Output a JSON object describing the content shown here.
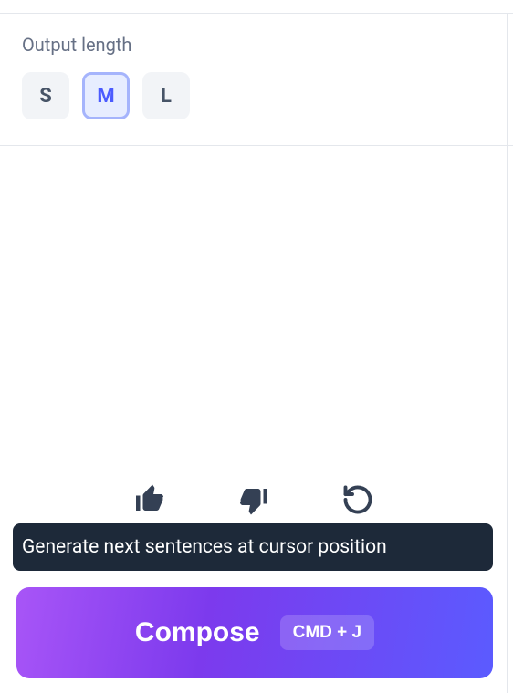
{
  "output_length": {
    "label": "Output length",
    "options": {
      "s": "S",
      "m": "M",
      "l": "L"
    },
    "selected": "m"
  },
  "feedback": {
    "thumbs_up": "thumbs-up",
    "thumbs_down": "thumbs-down",
    "regenerate": "regenerate"
  },
  "tooltip": {
    "text": "Generate next sentences at cursor position"
  },
  "compose": {
    "label": "Compose",
    "shortcut": "CMD + J"
  }
}
